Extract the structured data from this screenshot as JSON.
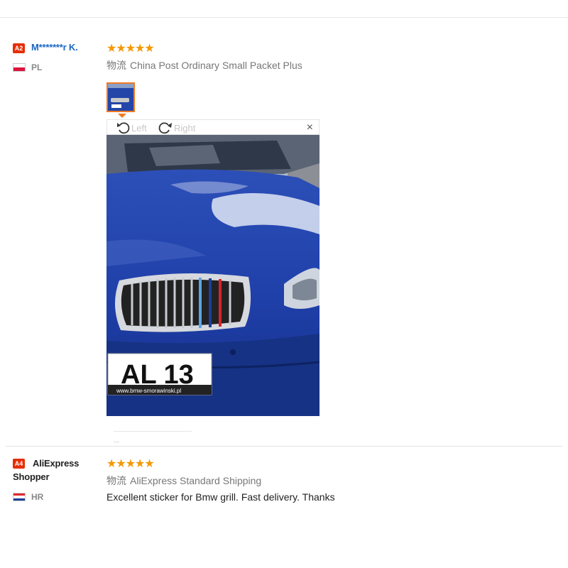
{
  "reviews": [
    {
      "badge": "A2",
      "user": "M*******r K.",
      "country": "PL",
      "rating": 5,
      "stars_text": "★★★★★",
      "logistics_label": "物流",
      "logistics_value": "China Post Ordinary Small Packet Plus",
      "viewer": {
        "rotate_left": "Left",
        "rotate_right": "Right",
        "close": "×",
        "plate_text": "AL 13",
        "dealer_text": "www.bmw-smorawinski.pl"
      }
    },
    {
      "badge": "A4",
      "user_line1": "AliExpress",
      "user_line2": "Shopper",
      "country": "HR",
      "rating": 5,
      "stars_text": "★★★★★",
      "logistics_label": "物流",
      "logistics_value": "AliExpress Standard Shipping",
      "text": "Excellent sticker for Bmw grill. Fast delivery. Thanks"
    }
  ],
  "icons": {
    "rotate_left": "rotate-left-icon",
    "rotate_right": "rotate-right-icon",
    "close": "close-icon"
  },
  "colors": {
    "accent": "#e62e04",
    "star": "#f39800",
    "user_link": "#1a66c2",
    "thumb_border": "#f07a22",
    "car_blue": "#1c3a9c"
  }
}
